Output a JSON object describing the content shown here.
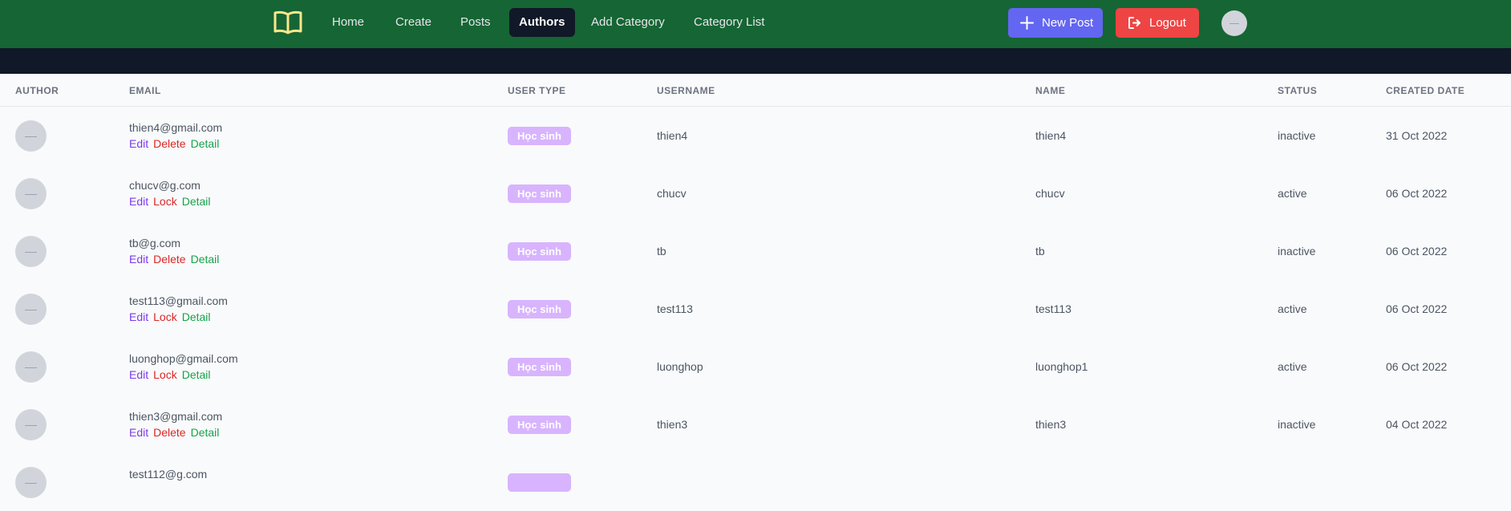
{
  "nav": {
    "links": [
      {
        "label": "Home",
        "active": false
      },
      {
        "label": "Create",
        "active": false
      },
      {
        "label": "Posts",
        "active": false
      },
      {
        "label": "Authors",
        "active": true
      },
      {
        "label": "Add Category",
        "active": false
      },
      {
        "label": "Category List",
        "active": false
      }
    ],
    "new_post_label": "New Post",
    "logout_label": "Logout",
    "logo_icon": "open-book-icon",
    "colors": {
      "navbar": "#166534",
      "active_link": "#111827",
      "new_post": "#6366f1",
      "logout": "#ef4444",
      "logo": "#fde68a"
    }
  },
  "table": {
    "headers": {
      "author": "AUTHOR",
      "email": "EMAIL",
      "user_type": "USER TYPE",
      "username": "USERNAME",
      "name": "NAME",
      "status": "STATUS",
      "created": "CREATED DATE"
    },
    "rows": [
      {
        "email": "thien4@gmail.com",
        "actions": [
          "Edit",
          "Delete",
          "Detail"
        ],
        "user_type": "Học sinh",
        "username": "thien4",
        "name": "thien4",
        "status": "inactive",
        "created": "31 Oct 2022"
      },
      {
        "email": "chucv@g.com",
        "actions": [
          "Edit",
          "Lock",
          "Detail"
        ],
        "user_type": "Học sinh",
        "username": "chucv",
        "name": "chucv",
        "status": "active",
        "created": "06 Oct 2022"
      },
      {
        "email": "tb@g.com",
        "actions": [
          "Edit",
          "Delete",
          "Detail"
        ],
        "user_type": "Học sinh",
        "username": "tb",
        "name": "tb",
        "status": "inactive",
        "created": "06 Oct 2022"
      },
      {
        "email": "test113@gmail.com",
        "actions": [
          "Edit",
          "Lock",
          "Detail"
        ],
        "user_type": "Học sinh",
        "username": "test113",
        "name": "test113",
        "status": "active",
        "created": "06 Oct 2022"
      },
      {
        "email": "luonghop@gmail.com",
        "actions": [
          "Edit",
          "Lock",
          "Detail"
        ],
        "user_type": "Học sinh",
        "username": "luonghop",
        "name": "luonghop1",
        "status": "active",
        "created": "06 Oct 2022"
      },
      {
        "email": "thien3@gmail.com",
        "actions": [
          "Edit",
          "Delete",
          "Detail"
        ],
        "user_type": "Học sinh",
        "username": "thien3",
        "name": "thien3",
        "status": "inactive",
        "created": "04 Oct 2022"
      },
      {
        "email": "test112@g.com",
        "actions": [],
        "user_type": "",
        "username": "",
        "name": "",
        "status": "",
        "created": ""
      }
    ]
  }
}
